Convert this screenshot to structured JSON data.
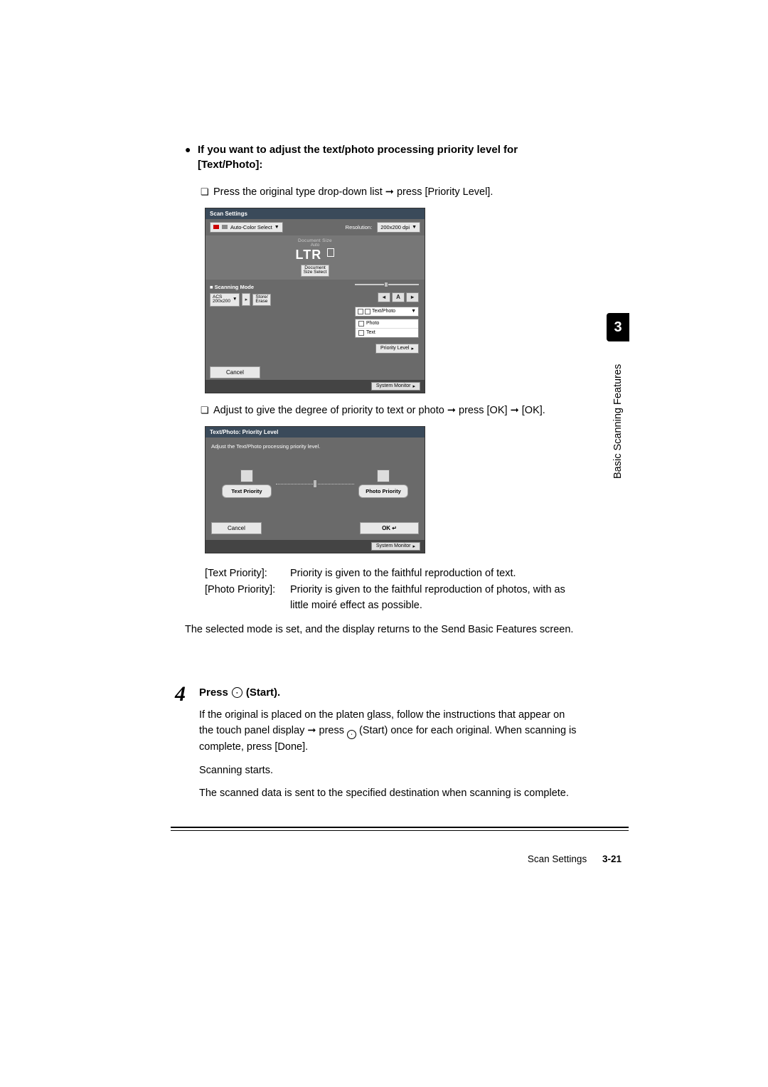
{
  "heading": "If you want to adjust the text/photo processing priority level for [Text/Photo]:",
  "instr1_pre": "Press the original type drop-down list ",
  "instr1_post": " press [Priority Level].",
  "instr2_pre": "Adjust to give the degree of priority to text or photo ",
  "instr2_mid": " press [OK] ",
  "instr2_post": " [OK].",
  "arrow": "➞",
  "screenshot1": {
    "title": "Scan Settings",
    "auto_color": "Auto-Color Select",
    "resolution_label": "Resolution:",
    "resolution_value": "200x200 dpi",
    "doc_size_label": "Document Size",
    "auto_label": "Auto",
    "ltr": "LTR",
    "doc_size_select": "Document\nSize Select",
    "scan_mode_label": "Scanning Mode",
    "acs_line1": "ACS",
    "acs_line2": "200x200",
    "store_erase": "Store/\nErase",
    "adj_left": "◂",
    "adj_mid": "A",
    "adj_right": "▸",
    "text_photo": "Text/Photo",
    "priority_level": "Priority Level",
    "menu_photo": "Photo",
    "menu_text": "Text",
    "cancel": "Cancel",
    "system_monitor": "System Monitor"
  },
  "screenshot2": {
    "title": "Text/Photo: Priority Level",
    "instr": "Adjust the Text/Photo processing priority level.",
    "text_priority": "Text Priority",
    "photo_priority": "Photo Priority",
    "cancel": "Cancel",
    "ok": "OK",
    "system_monitor": "System Monitor"
  },
  "defs": {
    "text_priority_label": "[Text Priority]:",
    "text_priority_desc": "Priority is given to the faithful reproduction of text.",
    "photo_priority_label": "[Photo Priority]:",
    "photo_priority_desc": "Priority is given to the faithful reproduction of photos, with as little moiré effect as possible."
  },
  "result_text": "The selected mode is set, and the display returns to the Send Basic Features screen.",
  "step4": {
    "num": "4",
    "head_pre": "Press ",
    "head_post": " (Start).",
    "p1_pre": "If the original is placed on the platen glass, follow the instructions that appear on the touch panel display ",
    "p1_mid": " press ",
    "p1_post": " (Start) once for each original. When scanning is complete, press [Done].",
    "p2": "Scanning starts.",
    "p3": "The scanned data is sent to the specified destination when scanning is complete."
  },
  "side": {
    "chapter": "3",
    "label": "Basic Scanning Features"
  },
  "footer": {
    "section": "Scan Settings",
    "page": "3-21"
  }
}
